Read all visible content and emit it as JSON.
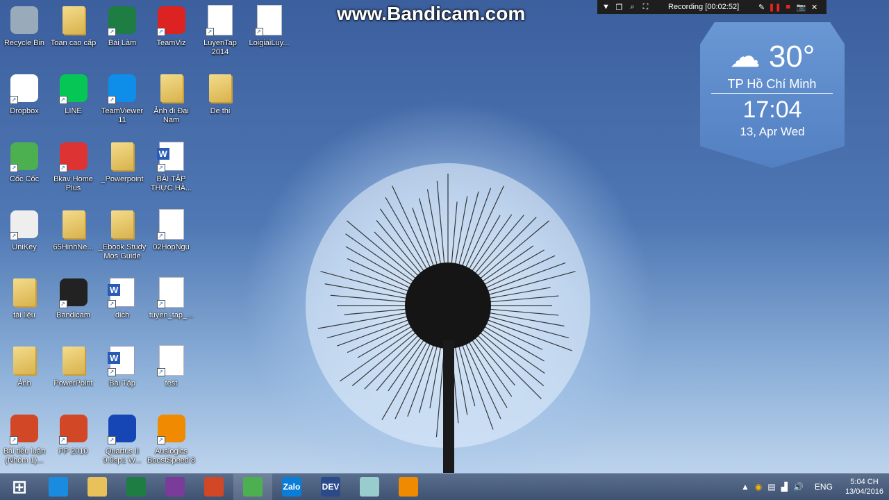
{
  "watermark": "www.Bandicam.com",
  "recorder": {
    "status": "Recording [00:02:52]"
  },
  "weather": {
    "temperature": "30°",
    "city": "TP Hồ Chí Minh",
    "time": "17:04",
    "date": "13, Apr Wed"
  },
  "desktop_icons": [
    {
      "label": "Recycle Bin",
      "icon": "recycle-bin-icon"
    },
    {
      "label": "Toan cao cấp",
      "icon": "folder-icon"
    },
    {
      "label": "Bài Làm",
      "icon": "excel-icon"
    },
    {
      "label": "TeamViz",
      "icon": "teamviz-icon"
    },
    {
      "label": "LuyenTap 2014",
      "icon": "document-icon"
    },
    {
      "label": "LoigiaiLuy...",
      "icon": "document-icon"
    },
    {
      "label": "Dropbox",
      "icon": "dropbox-icon"
    },
    {
      "label": "LINE",
      "icon": "line-icon"
    },
    {
      "label": "TeamViewer 11",
      "icon": "teamviewer-icon"
    },
    {
      "label": "Ảnh đi Đại Nam",
      "icon": "folder-icon"
    },
    {
      "label": "De thi",
      "icon": "folder-icon"
    },
    {
      "label": "Cốc Cốc",
      "icon": "coccoc-icon"
    },
    {
      "label": "Bkav Home Plus",
      "icon": "bkav-icon"
    },
    {
      "label": "_Powerpoint",
      "icon": "folder-icon"
    },
    {
      "label": "BÀI TẬP THỰC HÀ...",
      "icon": "word-icon"
    },
    {
      "label": "UniKey",
      "icon": "unikey-icon"
    },
    {
      "label": "65HinhNe...",
      "icon": "folder-icon"
    },
    {
      "label": "_Ebook Study Mos Guide",
      "icon": "folder-icon"
    },
    {
      "label": "02HopNgu",
      "icon": "document-icon"
    },
    {
      "label": "tài liệu",
      "icon": "folder-icon"
    },
    {
      "label": "Bandicam",
      "icon": "bandicam-icon"
    },
    {
      "label": "dich",
      "icon": "word-icon"
    },
    {
      "label": "tuyen_tap_...",
      "icon": "document-icon"
    },
    {
      "label": "Ảnh",
      "icon": "folder-icon"
    },
    {
      "label": "PowerPoint",
      "icon": "folder-icon"
    },
    {
      "label": "Bài Tập",
      "icon": "word-icon"
    },
    {
      "label": "test",
      "icon": "text-file-icon"
    },
    {
      "label": "Bài tiểu luận (Nhóm 1)...",
      "icon": "powerpoint-icon"
    },
    {
      "label": "PP 2010",
      "icon": "powerpoint-icon"
    },
    {
      "label": "Quartus II 9.0sp1 W...",
      "icon": "quartus-icon"
    },
    {
      "label": "Auslogics BoostSpeed 8",
      "icon": "auslogics-icon"
    }
  ],
  "taskbar": {
    "apps": [
      {
        "name": "start-button",
        "icon": "windows-icon"
      },
      {
        "name": "internet-explorer",
        "icon": "ie-icon"
      },
      {
        "name": "file-explorer",
        "icon": "folder-icon"
      },
      {
        "name": "store",
        "icon": "store-icon"
      },
      {
        "name": "onenote",
        "icon": "onenote-icon"
      },
      {
        "name": "photos",
        "icon": "photos-icon"
      },
      {
        "name": "coccoc",
        "icon": "coccoc-icon"
      },
      {
        "name": "zalo",
        "icon": "zalo-icon",
        "text": "Zalo"
      },
      {
        "name": "devcpp",
        "icon": "dev-icon",
        "text": "DEV"
      },
      {
        "name": "app",
        "icon": "app-icon"
      },
      {
        "name": "auslogics",
        "icon": "auslogics-icon"
      }
    ],
    "language": "ENG",
    "clock_time": "5:04 CH",
    "clock_date": "13/04/2016"
  },
  "colors": {
    "taskbar": "#4a5d7e",
    "desktop": "#4f78b4",
    "recording_red": "#e22222"
  }
}
